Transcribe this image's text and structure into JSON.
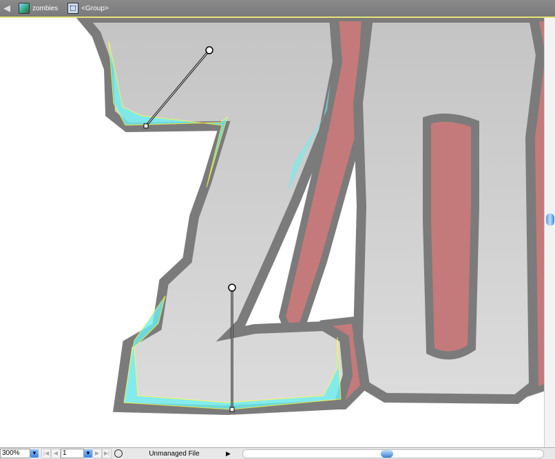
{
  "breadcrumb": {
    "layer": "zombies",
    "group": "<Group>"
  },
  "status": {
    "zoom": "300%",
    "page": "1",
    "file_status": "Unmanaged File"
  },
  "icons": [
    "back-arrow-icon",
    "layer-icon",
    "group-icon",
    "first-page-icon",
    "prev-page-icon",
    "next-page-icon",
    "last-page-icon",
    "version-cue-icon",
    "play-triangle-icon"
  ],
  "colors": {
    "fill": "#cdcdcd",
    "outline": "#7b7b7b",
    "flesh": "#c47a7a",
    "highlight": "#6ef0f0",
    "selection": "#ffff40"
  }
}
